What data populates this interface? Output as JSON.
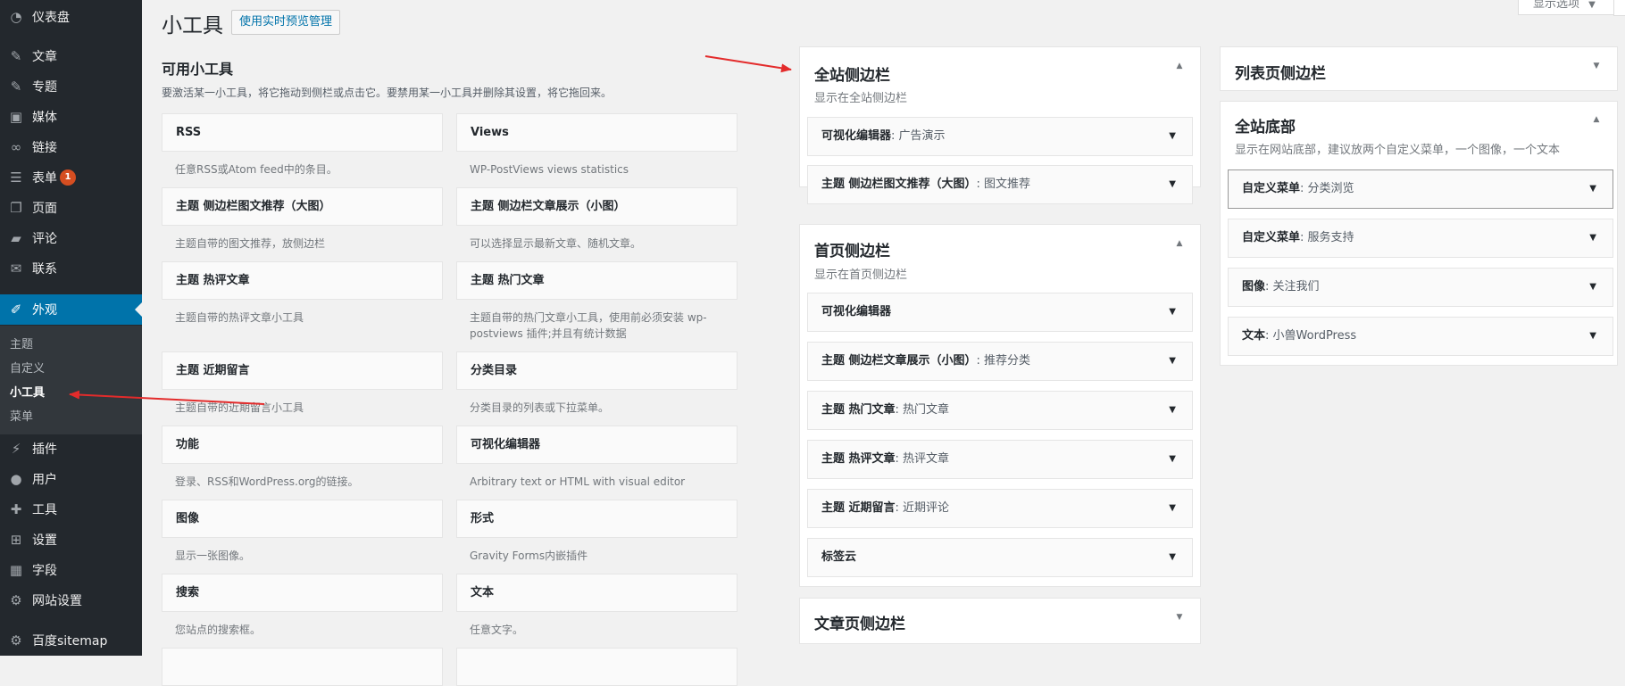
{
  "colors": {
    "sidebar_bg": "#23282d",
    "submenu_bg": "#32373c",
    "accent": "#0073aa",
    "badge": "#d54e21",
    "annotation_arrow": "#e32b2b"
  },
  "menu": {
    "items": [
      {
        "label": "仪表盘",
        "icon": "dashboard-icon"
      },
      {
        "label": "文章",
        "icon": "pin-icon"
      },
      {
        "label": "专题",
        "icon": "pin-icon"
      },
      {
        "label": "媒体",
        "icon": "media-icon"
      },
      {
        "label": "链接",
        "icon": "link-icon"
      },
      {
        "label": "表单",
        "icon": "form-icon",
        "badge": "1"
      },
      {
        "label": "页面",
        "icon": "page-icon"
      },
      {
        "label": "评论",
        "icon": "comment-icon"
      },
      {
        "label": "联系",
        "icon": "mail-icon"
      },
      {
        "label": "外观",
        "icon": "appearance-icon"
      },
      {
        "label": "插件",
        "icon": "plugin-icon"
      },
      {
        "label": "用户",
        "icon": "user-icon"
      },
      {
        "label": "工具",
        "icon": "tools-icon"
      },
      {
        "label": "设置",
        "icon": "settings-icon"
      },
      {
        "label": "字段",
        "icon": "fields-icon"
      },
      {
        "label": "网站设置",
        "icon": "gear-icon"
      },
      {
        "label": "百度sitemap",
        "icon": "gear-icon"
      }
    ],
    "submenu": [
      "主题",
      "自定义",
      "小工具",
      "菜单"
    ]
  },
  "header": {
    "title": "小工具",
    "preview_button": "使用实时预览管理",
    "screen_options": "显示选项"
  },
  "available": {
    "heading": "可用小工具",
    "description": "要激活某一小工具，将它拖动到侧栏或点击它。要禁用某一小工具并删除其设置，将它拖回来。",
    "widgets": [
      {
        "name": "RSS",
        "desc": "任意RSS或Atom feed中的条目。"
      },
      {
        "name": "Views",
        "desc": "WP-PostViews views statistics"
      },
      {
        "name": "主题  侧边栏图文推荐（大图）",
        "desc": "主题自带的图文推荐，放侧边栏"
      },
      {
        "name": "主题  侧边栏文章展示（小图）",
        "desc": "可以选择显示最新文章、随机文章。"
      },
      {
        "name": "主题  热评文章",
        "desc": "主题自带的热评文章小工具"
      },
      {
        "name": "主题  热门文章",
        "desc": "主题自带的热门文章小工具，使用前必须安装 wp-postviews 插件;并且有统计数据"
      },
      {
        "name": "主题  近期留言",
        "desc": "主题自带的近期留言小工具"
      },
      {
        "name": "分类目录",
        "desc": "分类目录的列表或下拉菜单。"
      },
      {
        "name": "功能",
        "desc": "登录、RSS和WordPress.org的链接。"
      },
      {
        "name": "可视化编辑器",
        "desc": "Arbitrary text or HTML with visual editor"
      },
      {
        "name": "图像",
        "desc": "显示一张图像。"
      },
      {
        "name": "形式",
        "desc": "Gravity Forms内嵌插件"
      },
      {
        "name": "搜索",
        "desc": "您站点的搜索框。"
      },
      {
        "name": "文本",
        "desc": "任意文字。"
      }
    ]
  },
  "sidebars": {
    "site_sidebar": {
      "title": "全站侧边栏",
      "desc": "显示在全站侧边栏",
      "widgets": [
        {
          "name": "可视化编辑器",
          "title": "广告演示"
        },
        {
          "name": "主题  侧边栏图文推荐（大图）",
          "title": "图文推荐"
        }
      ]
    },
    "home_sidebar": {
      "title": "首页侧边栏",
      "desc": "显示在首页侧边栏",
      "widgets": [
        {
          "name": "可视化编辑器",
          "title": ""
        },
        {
          "name": "主题  侧边栏文章展示（小图）",
          "title": "推荐分类"
        },
        {
          "name": "主题  热门文章",
          "title": "热门文章"
        },
        {
          "name": "主题  热评文章",
          "title": "热评文章"
        },
        {
          "name": "主题  近期留言",
          "title": "近期评论"
        },
        {
          "name": "标签云",
          "title": ""
        }
      ]
    },
    "article_sidebar": {
      "title": "文章页侧边栏"
    },
    "list_sidebar": {
      "title": "列表页侧边栏"
    },
    "footer": {
      "title": "全站底部",
      "desc": "显示在网站底部，建议放两个自定义菜单，一个图像，一个文本",
      "widgets": [
        {
          "name": "自定义菜单",
          "title": "分类浏览"
        },
        {
          "name": "自定义菜单",
          "title": "服务支持"
        },
        {
          "name": "图像",
          "title": "关注我们"
        },
        {
          "name": "文本",
          "title": "小兽WordPress"
        }
      ]
    }
  }
}
